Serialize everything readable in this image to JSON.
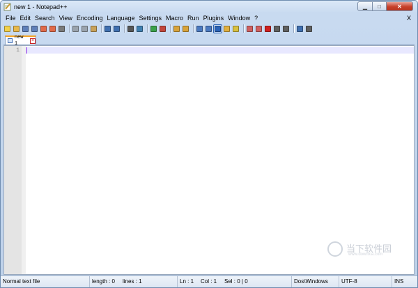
{
  "window": {
    "title": "new 1 - Notepad++"
  },
  "menu": {
    "items": [
      "File",
      "Edit",
      "Search",
      "View",
      "Encoding",
      "Language",
      "Settings",
      "Macro",
      "Run",
      "Plugins",
      "Window",
      "?"
    ],
    "close_label": "X"
  },
  "toolbar": {
    "buttons": [
      {
        "icon": "new-file-icon",
        "color": "#f2d14a"
      },
      {
        "icon": "open-file-icon",
        "color": "#e8b84a"
      },
      {
        "icon": "save-icon",
        "color": "#5f7fb8"
      },
      {
        "icon": "save-all-icon",
        "color": "#5f7fb8"
      },
      {
        "icon": "close-file-icon",
        "color": "#e06a4a"
      },
      {
        "icon": "close-all-icon",
        "color": "#e06a4a"
      },
      {
        "icon": "print-icon",
        "color": "#7a7a7a"
      },
      {
        "icon": "cut-icon",
        "color": "#9aa3ad"
      },
      {
        "icon": "copy-icon",
        "color": "#9aa3ad"
      },
      {
        "icon": "paste-icon",
        "color": "#c8a25a"
      },
      {
        "icon": "undo-icon",
        "color": "#3f6fb0"
      },
      {
        "icon": "redo-icon",
        "color": "#3f6fb0"
      },
      {
        "icon": "find-icon",
        "color": "#555555"
      },
      {
        "icon": "replace-icon",
        "color": "#3f7fb0"
      },
      {
        "icon": "zoom-in-icon",
        "color": "#39a14a"
      },
      {
        "icon": "zoom-out-icon",
        "color": "#c2453b"
      },
      {
        "icon": "sync-vertical-icon",
        "color": "#d8a33a"
      },
      {
        "icon": "sync-horizontal-icon",
        "color": "#d8a33a"
      },
      {
        "icon": "word-wrap-icon",
        "color": "#4a79c0"
      },
      {
        "icon": "show-all-chars-icon",
        "color": "#4a79c0"
      },
      {
        "icon": "indent-guide-icon",
        "color": "#2a63b7",
        "selected": true
      },
      {
        "icon": "language-icon",
        "color": "#e0b040"
      },
      {
        "icon": "doc-map-icon",
        "color": "#d8c040"
      },
      {
        "icon": "function-list-icon",
        "color": "#d06060"
      },
      {
        "icon": "folder-workspace-icon",
        "color": "#d06060"
      },
      {
        "icon": "record-macro-icon",
        "color": "#d02020"
      },
      {
        "icon": "stop-macro-icon",
        "color": "#606060"
      },
      {
        "icon": "play-macro-icon",
        "color": "#606060"
      },
      {
        "icon": "run-macro-multiple-icon",
        "color": "#3f6fb0"
      },
      {
        "icon": "save-macro-icon",
        "color": "#606060"
      }
    ]
  },
  "tabs": [
    {
      "label": "new 1",
      "active": true
    }
  ],
  "editor": {
    "line_numbers": [
      "1"
    ]
  },
  "watermark": {
    "text": "当下软件园",
    "subtext": "www.downxia.com"
  },
  "statusbar": {
    "doc_type": "Normal text file",
    "length": "length : 0",
    "lines": "lines : 1",
    "ln": "Ln : 1",
    "col": "Col : 1",
    "sel": "Sel : 0 | 0",
    "eol": "Dos\\Windows",
    "encoding": "UTF-8",
    "mode": "INS"
  }
}
